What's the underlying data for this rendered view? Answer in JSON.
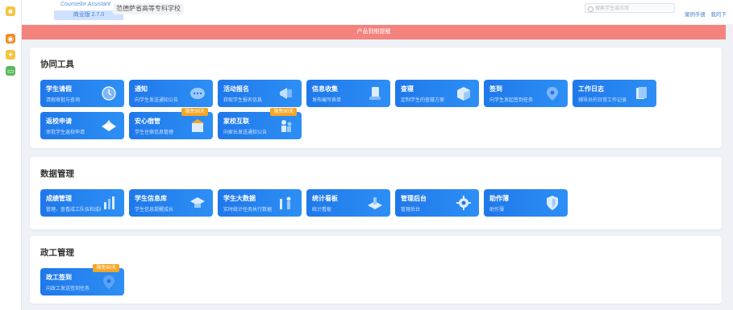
{
  "header": {
    "logo_text": "Counselor Assistant",
    "version": "商业版 2.7.0",
    "school_name": "范德萨省高等专科学校",
    "search_placeholder": "搜索学生或应用",
    "links": "案例手册　我的下"
  },
  "banner": {
    "text": "产品到期提醒",
    "color": "#f4827d"
  },
  "sections": [
    {
      "title": "协同工具",
      "tiles": [
        {
          "title": "学生请假",
          "desc": "请假审批与查询",
          "icon": "clock-icon"
        },
        {
          "title": "通知",
          "desc": "向学生发送通知公告",
          "icon": "chat-icon"
        },
        {
          "title": "活动报名",
          "desc": "获取学生报名信息",
          "icon": "megaphone-icon"
        },
        {
          "title": "信息收集",
          "desc": "发布编写表单",
          "icon": "phone-icon"
        },
        {
          "title": "查寝",
          "desc": "定制学生的查寝方案",
          "icon": "box-icon"
        },
        {
          "title": "签到",
          "desc": "向学生发起签到任务",
          "icon": "pin-icon"
        },
        {
          "title": "工作日志",
          "desc": "辅导员的日常工作记录",
          "icon": "book-icon"
        },
        {
          "title": "返校申请",
          "desc": "审批学生返校申请",
          "icon": "cube-icon"
        },
        {
          "title": "安心宿管",
          "desc": "学生住宿信息管理",
          "icon": "building-icon",
          "badge": "限免90天"
        },
        {
          "title": "家校互联",
          "desc": "向家长发送通知公告",
          "icon": "family-icon",
          "badge": "限免90天"
        }
      ]
    },
    {
      "title": "数据管理",
      "tiles": [
        {
          "title": "成绩管理",
          "desc": "管理、查看成工队伍和成绩",
          "icon": "chart-building-icon"
        },
        {
          "title": "学生信息库",
          "desc": "学生信息提醒成长",
          "icon": "graduation-cap-icon"
        },
        {
          "title": "学生大数据",
          "desc": "实时统计任务执行数据",
          "icon": "data-person-icon"
        },
        {
          "title": "统计看板",
          "desc": "统计看板",
          "icon": "dashboard-icon"
        },
        {
          "title": "管理后台",
          "desc": "管理后台",
          "icon": "gear-icon"
        },
        {
          "title": "助作薄",
          "desc": "助作薄",
          "icon": "shield-icon"
        }
      ]
    },
    {
      "title": "政工管理",
      "tiles": [
        {
          "title": "政工签到",
          "desc": "向政工发送签到任务",
          "icon": "pin-icon",
          "badge": "限免90天"
        }
      ]
    }
  ],
  "colors": {
    "tile": "#1f78ea",
    "badge": "#f5a623",
    "accent": "#4a7fd0"
  }
}
